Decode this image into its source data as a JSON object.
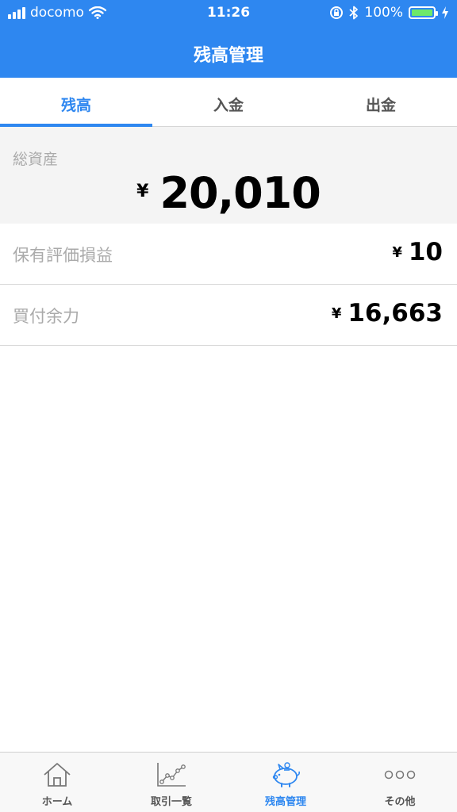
{
  "status_bar": {
    "carrier": "docomo",
    "time": "11:26",
    "battery": "100%"
  },
  "header": {
    "title": "残高管理"
  },
  "tabs": [
    {
      "label": "残高",
      "active": true
    },
    {
      "label": "入金",
      "active": false
    },
    {
      "label": "出金",
      "active": false
    }
  ],
  "total_assets": {
    "label": "総資産",
    "currency": "¥",
    "value": "20,010"
  },
  "rows": [
    {
      "label": "保有評価損益",
      "currency": "¥",
      "value": "10"
    },
    {
      "label": "買付余力",
      "currency": "¥",
      "value": "16,663"
    }
  ],
  "tab_bar": [
    {
      "label": "ホーム",
      "icon": "home-icon",
      "active": false
    },
    {
      "label": "取引一覧",
      "icon": "chart-line-icon",
      "active": false
    },
    {
      "label": "残高管理",
      "icon": "piggy-bank-icon",
      "active": true
    },
    {
      "label": "その他",
      "icon": "more-dots-icon",
      "active": false
    }
  ],
  "colors": {
    "brand": "#2e87f0",
    "battery": "#6ee96a"
  }
}
